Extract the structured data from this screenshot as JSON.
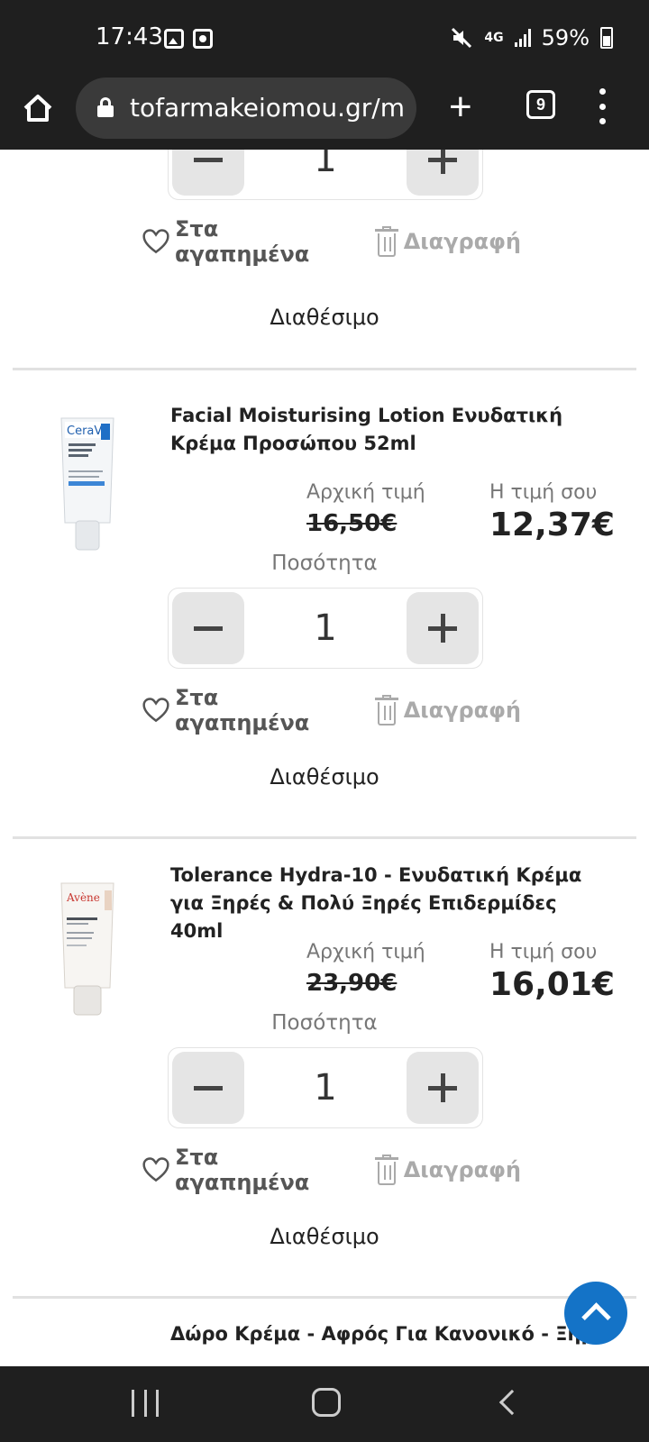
{
  "status_bar": {
    "time": "17:43",
    "network": "4G",
    "battery": "59%"
  },
  "browser": {
    "url": "tofarmakeiomou.gr/m",
    "tab_count": "9"
  },
  "labels": {
    "favorites": "Στα αγαπημένα",
    "delete": "Διαγραφή",
    "availability": "Διαθέσιμο",
    "original_price": "Αρχική τιμή",
    "your_price": "Η τιμή σου",
    "quantity": "Ποσότητα"
  },
  "items": [
    {
      "quantity": "1",
      "availability": "Διαθέσιμο"
    },
    {
      "title": "Facial Moisturising Lotion Ενυδατική Κρέμα Προσώπου 52ml",
      "brand": "CeraVe",
      "original_price": "16,50€",
      "your_price": "12,37€",
      "quantity": "1",
      "availability": "Διαθέσιμο"
    },
    {
      "title": "Tolerance Hydra-10 - Ενυδατική Κρέμα για Ξηρές & Πολύ Ξηρές Επιδερμίδες 40ml",
      "brand": "Avène",
      "original_price": "23,90€",
      "your_price": "16,01€",
      "quantity": "1",
      "availability": "Διαθέσιμο"
    },
    {
      "title": "Δώρο Κρέμα - Αφρός Για Κανονικό - Ξηρό"
    }
  ],
  "colors": {
    "accent": "#1473c7",
    "chrome": "#1f1f1f"
  }
}
